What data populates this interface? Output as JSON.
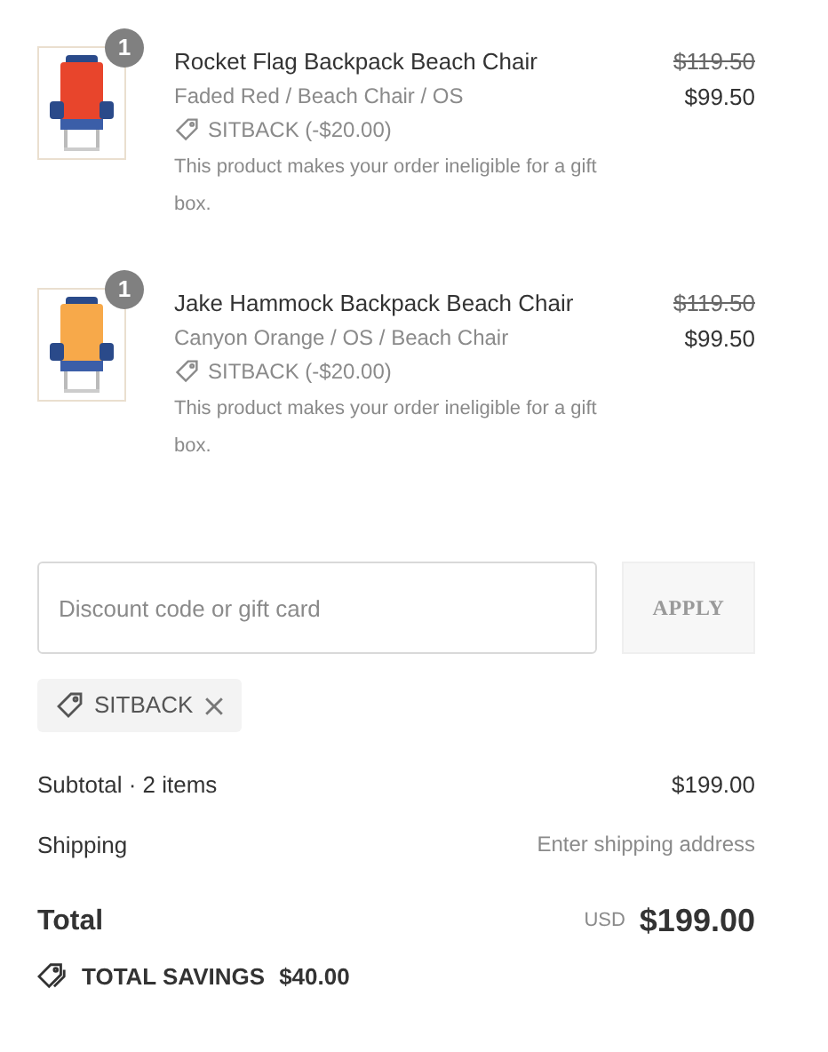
{
  "line_items": [
    {
      "quantity": "1",
      "name": "Rocket Flag Backpack Beach Chair",
      "variant": "Faded Red / Beach Chair / OS",
      "discount": "SITBACK (-$20.00)",
      "note": "This product makes your order ineligible for a gift box.",
      "original_price": "$119.50",
      "price": "$99.50"
    },
    {
      "quantity": "1",
      "name": "Jake Hammock Backpack Beach Chair",
      "variant": "Canyon Orange / OS / Beach Chair",
      "discount": "SITBACK (-$20.00)",
      "note": "This product makes your order ineligible for a gift box.",
      "original_price": "$119.50",
      "price": "$99.50"
    }
  ],
  "discount_field": {
    "placeholder": "Discount code or gift card"
  },
  "apply_button": "APPLY",
  "applied_codes": [
    "SITBACK"
  ],
  "summary": [
    {
      "label": "Subtotal · 2 items",
      "value": "$199.00",
      "kind": "amount"
    },
    {
      "label": "Shipping",
      "value": "Enter shipping address",
      "kind": "hint"
    }
  ],
  "total": {
    "label": "Total",
    "currency": "USD",
    "value": "$199.00"
  },
  "savings": {
    "label": "TOTAL SAVINGS",
    "value": "$40.00"
  }
}
